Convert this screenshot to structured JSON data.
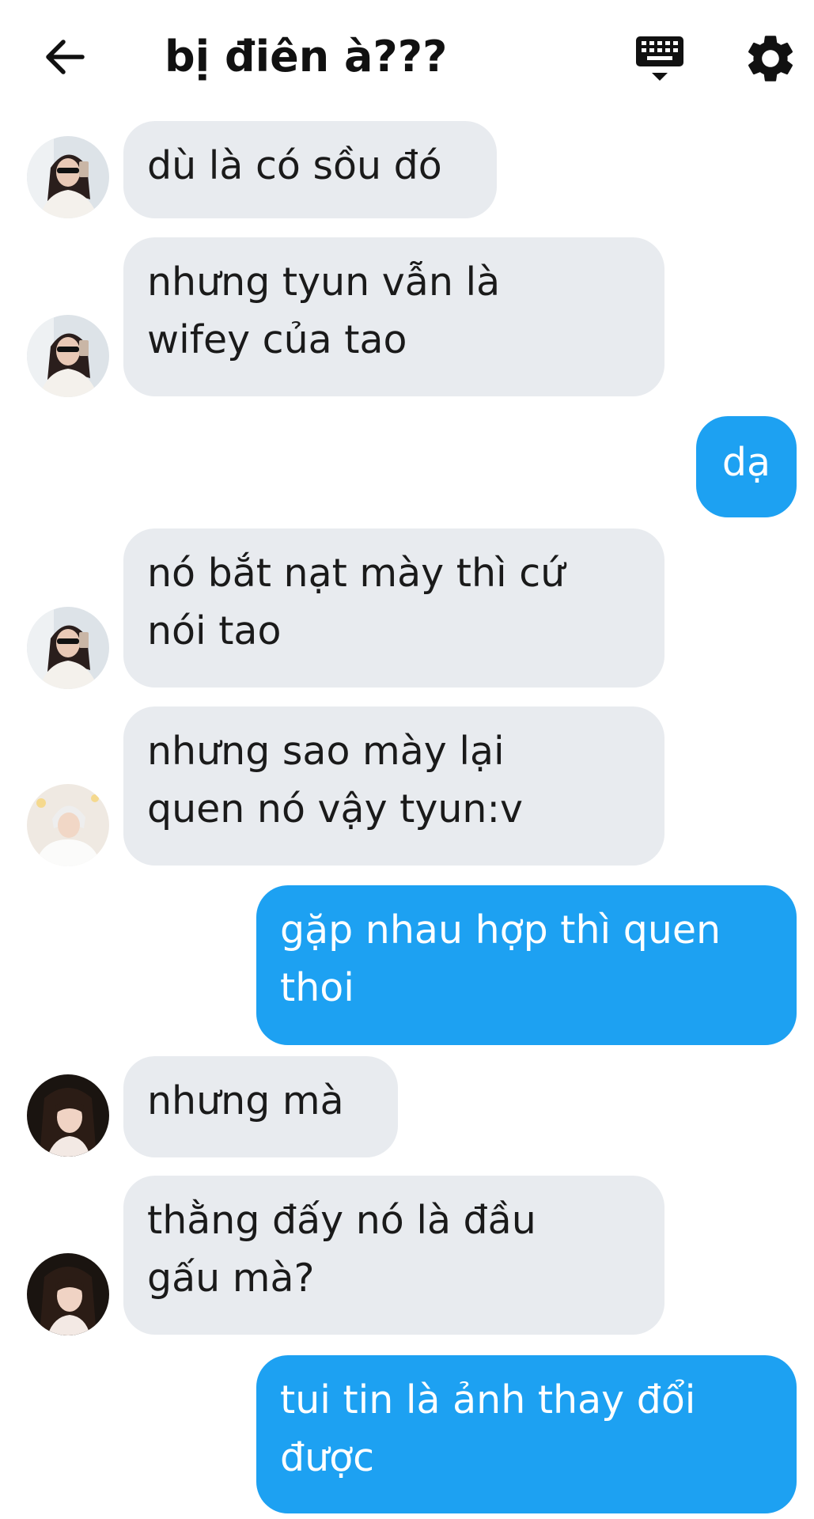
{
  "header": {
    "title": "bị điên à???",
    "back_icon": "arrow-left-icon",
    "keyboard_icon": "keyboard-icon",
    "settings_icon": "gear-icon"
  },
  "colors": {
    "incoming_bubble": "#e8ebef",
    "outgoing_bubble": "#1da1f2",
    "text_dark": "#1a1a1a"
  },
  "messages": [
    {
      "sender": "friend_a",
      "direction": "in",
      "text": "dù là có sồu đó"
    },
    {
      "sender": "friend_a",
      "direction": "in",
      "text": "nhưng tyun vẫn là\nwifey của tao"
    },
    {
      "sender": "me",
      "direction": "out",
      "text": "dạ"
    },
    {
      "sender": "friend_a",
      "direction": "in",
      "text": "nó bắt nạt mày thì cứ\nnói tao"
    },
    {
      "sender": "friend_b",
      "direction": "in",
      "text": "nhưng sao mày lại\nquen nó vậy tyun:v"
    },
    {
      "sender": "me",
      "direction": "out",
      "text": "gặp nhau hợp thì quen\nthoi"
    },
    {
      "sender": "friend_c",
      "direction": "in",
      "text": "nhưng mà"
    },
    {
      "sender": "friend_c",
      "direction": "in",
      "text": "thằng đấy nó là đầu\ngấu mà?"
    },
    {
      "sender": "me",
      "direction": "out",
      "text": "tui tin là ảnh thay đổi\nđược"
    }
  ]
}
